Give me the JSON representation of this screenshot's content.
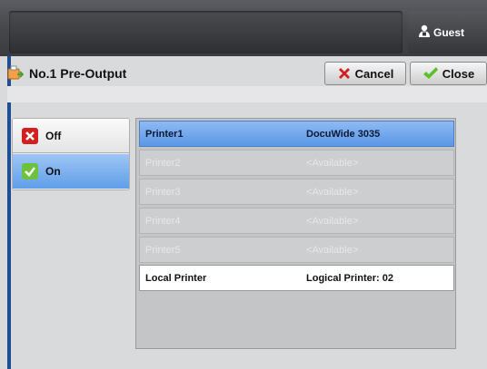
{
  "header": {
    "user_label": "Guest"
  },
  "title": {
    "text": "No.1 Pre-Output"
  },
  "buttons": {
    "cancel": "Cancel",
    "close": "Close"
  },
  "toggle": {
    "off": "Off",
    "on": "On",
    "selected": "On"
  },
  "printers": [
    {
      "name": "Printer1",
      "value": "DocuWide 3035",
      "state": "selected"
    },
    {
      "name": "Printer2",
      "value": "<Available>",
      "state": "available"
    },
    {
      "name": "Printer3",
      "value": "<Available>",
      "state": "available"
    },
    {
      "name": "Printer4",
      "value": "<Available>",
      "state": "available"
    },
    {
      "name": "Printer5",
      "value": "<Available>",
      "state": "available"
    },
    {
      "name": "Local Printer",
      "value": "Logical Printer: 02",
      "state": "local"
    }
  ],
  "colors": {
    "accent": "#5f9ee8",
    "cancel_icon": "#d21f1f",
    "check_icon": "#5cc02b"
  }
}
